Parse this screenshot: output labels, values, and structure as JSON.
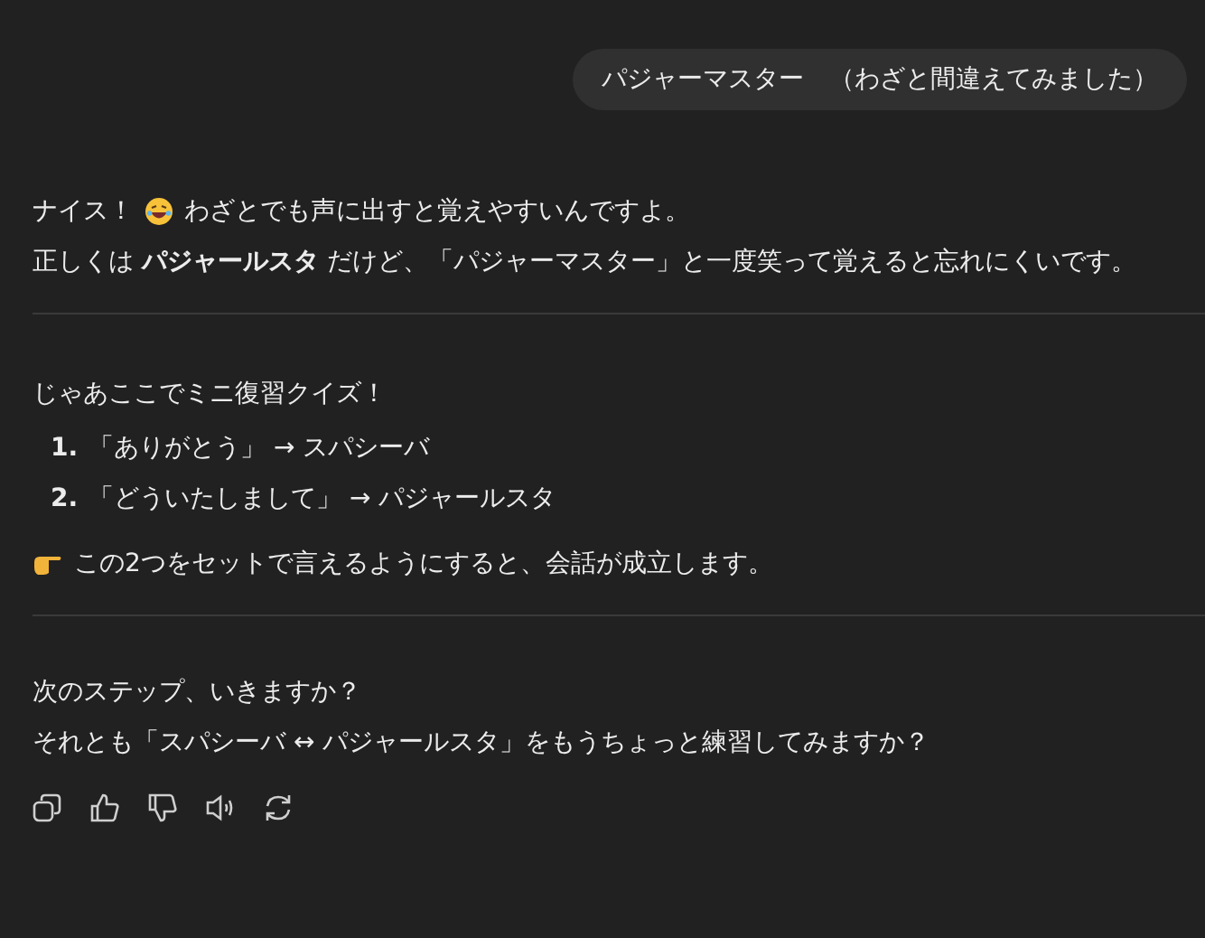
{
  "user_message": "パジャーマスター　（わざと間違えてみました）",
  "reply": {
    "intro_lines": [
      "ナイス！",
      "わざとでも声に出すと覚えやすいんですよ。",
      "正しくは **パジャールスタ** だけど、「パジャーマスター」と一度笑って覚えると忘れにくいです。"
    ],
    "quiz": {
      "title": "じゃあここでミニ復習クイズ！",
      "items": [
        {
          "number": "1.",
          "text": "「ありがとう」 → スパシーバ"
        },
        {
          "number": "2.",
          "text": "「どういたしまして」 → パジャールスタ"
        }
      ],
      "tip": "この2つをセットで言えるようにすると、会話が成立します。"
    },
    "closing_lines": [
      "次のステップ、いきますか？",
      "それとも「スパシーバ ↔ パジャールスタ」をもうちょっと練習してみますか？"
    ]
  }
}
